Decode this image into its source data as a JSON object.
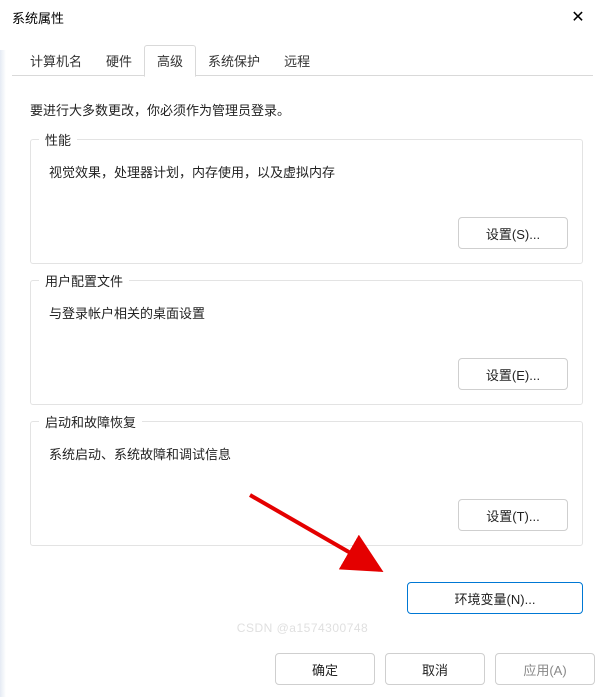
{
  "window": {
    "title": "系统属性"
  },
  "tabs": [
    {
      "label": "计算机名"
    },
    {
      "label": "硬件"
    },
    {
      "label": "高级"
    },
    {
      "label": "系统保护"
    },
    {
      "label": "远程"
    }
  ],
  "active_tab_index": 2,
  "content": {
    "intro": "要进行大多数更改，你必须作为管理员登录。",
    "groups": {
      "performance": {
        "legend": "性能",
        "desc": "视觉效果，处理器计划，内存使用，以及虚拟内存",
        "button": "设置(S)..."
      },
      "userprofile": {
        "legend": "用户配置文件",
        "desc": "与登录帐户相关的桌面设置",
        "button": "设置(E)..."
      },
      "startup": {
        "legend": "启动和故障恢复",
        "desc": "系统启动、系统故障和调试信息",
        "button": "设置(T)..."
      }
    },
    "env_button": "环境变量(N)..."
  },
  "footer": {
    "ok": "确定",
    "cancel": "取消",
    "apply": "应用(A)"
  },
  "watermark": "CSDN @a1574300748"
}
